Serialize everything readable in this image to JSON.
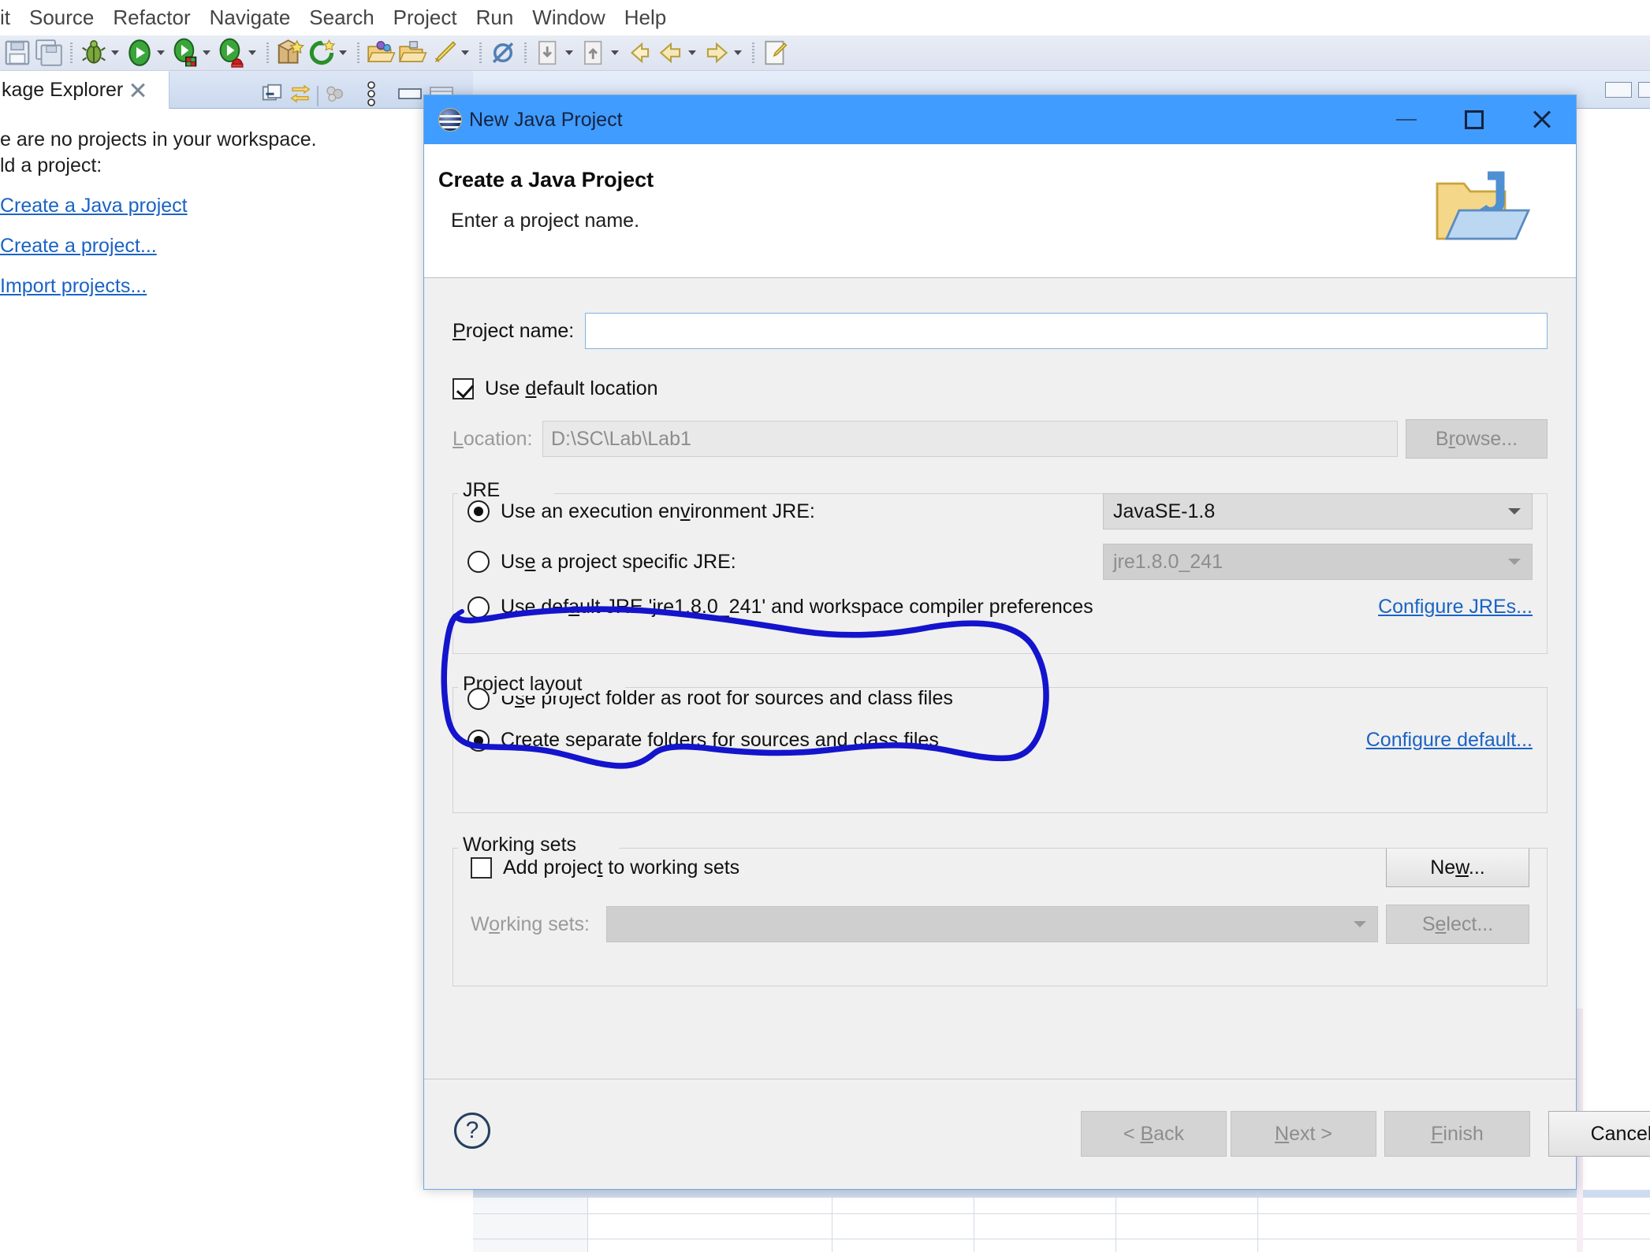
{
  "menu": {
    "items": [
      "it",
      "Source",
      "Refactor",
      "Navigate",
      "Search",
      "Project",
      "Run",
      "Window",
      "Help"
    ]
  },
  "toolbar": {
    "icons": [
      "save-icon",
      "save-all-icon",
      "debug-icon",
      "run-icon",
      "run-configurations-icon",
      "coverage-icon",
      "new-java-package-icon",
      "new-annotation-icon",
      "open-type-icon",
      "open-task-icon",
      "toggle-mark-occurrences-icon",
      "skip-all-breakpoints-icon",
      "previous-annotation-icon",
      "next-annotation-icon",
      "back-icon",
      "forward-icon",
      "new-editor-icon"
    ]
  },
  "package_explorer": {
    "tab_label": "kage Explorer",
    "close_icon": "close-icon",
    "tools": [
      "collapse-all-icon",
      "link-with-editor-icon",
      "filters-icon",
      "view-menu-icon",
      "minimize-icon",
      "maximize-icon"
    ],
    "empty_text_line1": "e are no projects in your workspace.",
    "empty_text_line2": "ld a project:",
    "links": [
      "Create a Java project",
      "Create a project...",
      "Import projects..."
    ]
  },
  "dialog": {
    "icon": "java-project-icon",
    "title": "New Java Project",
    "window_controls": {
      "minimize": "minimize-icon",
      "maximize": "maximize-icon",
      "close": "close-icon"
    },
    "header": {
      "heading": "Create a Java Project",
      "subtitle": "Enter a project name.",
      "banner_icon": "java-project-folder-icon"
    },
    "project_name": {
      "label": "Project name:",
      "label_mnemonic": "P",
      "value": "",
      "placeholder": ""
    },
    "use_default_location": {
      "label": "Use default location",
      "label_pre": "Use ",
      "label_mnemonic": "d",
      "label_post": "efault location",
      "checked": true
    },
    "location": {
      "label": "Location:",
      "label_mnemonic": "L",
      "value": "D:\\SC\\Lab\\Lab1",
      "enabled": false,
      "browse_label": "Browse...",
      "browse_mnemonic": "r",
      "browse_enabled": false
    },
    "jre": {
      "legend": "JRE",
      "options": [
        {
          "label": "Use an execution environment JRE:",
          "pre": "Use an execution en",
          "mnemonic": "v",
          "post": "ironment JRE:",
          "selected": true,
          "combo_value": "JavaSE-1.8",
          "combo_enabled": true
        },
        {
          "label": "Use a project specific JRE:",
          "pre": "Us",
          "mnemonic": "e",
          "post": " a project specific JRE:",
          "selected": false,
          "combo_value": "jre1.8.0_241",
          "combo_enabled": false
        },
        {
          "label": "Use default JRE 'jre1.8.0_241' and workspace compiler preferences",
          "pre": "Use def",
          "mnemonic": "a",
          "post": "ult JRE 'jre1.8.0_241' and workspace compiler preferences",
          "selected": false
        }
      ],
      "configure_link": "Configure JREs..."
    },
    "project_layout": {
      "legend": "Project layout",
      "options": [
        {
          "label": "Use project folder as root for sources and class files",
          "pre": "U",
          "mnemonic": "s",
          "post": "e project folder as root for sources and class files",
          "selected": false
        },
        {
          "label": "Create separate folders for sources and class files",
          "pre": "",
          "mnemonic": "C",
          "post": "reate separate folders for sources and class files",
          "selected": true
        }
      ],
      "configure_link": "Configure default...",
      "annotation": {
        "type": "hand-drawn-circle",
        "color": "#1414cc"
      }
    },
    "working_sets": {
      "legend": "Working sets",
      "add_checkbox": {
        "label": "Add project to working sets",
        "pre": "Add projec",
        "mnemonic": "t",
        "post": " to working sets",
        "checked": false
      },
      "new_button": {
        "label": "New...",
        "pre": "Ne",
        "mnemonic": "w",
        "post": "...",
        "enabled": true
      },
      "sets_label": "Working sets:",
      "sets_label_pre": "W",
      "sets_label_mnemonic": "o",
      "sets_label_post": "rking sets:",
      "sets_value": "",
      "sets_enabled": false,
      "select_button": {
        "label": "Select...",
        "pre": "S",
        "mnemonic": "e",
        "post": "lect...",
        "enabled": false
      }
    },
    "footer": {
      "help_icon": "help-icon",
      "buttons": [
        {
          "label": "< Back",
          "pre": "< ",
          "mnemonic": "B",
          "post": "ack",
          "enabled": false
        },
        {
          "label": "Next >",
          "pre": "",
          "mnemonic": "N",
          "post": "ext >",
          "enabled": false
        },
        {
          "label": "Finish",
          "pre": "",
          "mnemonic": "F",
          "post": "inish",
          "enabled": false
        },
        {
          "label": "Cancel",
          "pre": "",
          "mnemonic": "",
          "post": "Cancel",
          "enabled": true
        }
      ]
    }
  },
  "colors": {
    "titlebar": "#409cff",
    "dialog_bg": "#f0f0f0",
    "link": "#1a63c4",
    "annotation": "#1414cc",
    "toolbar_bg": "#e0e6f2"
  }
}
